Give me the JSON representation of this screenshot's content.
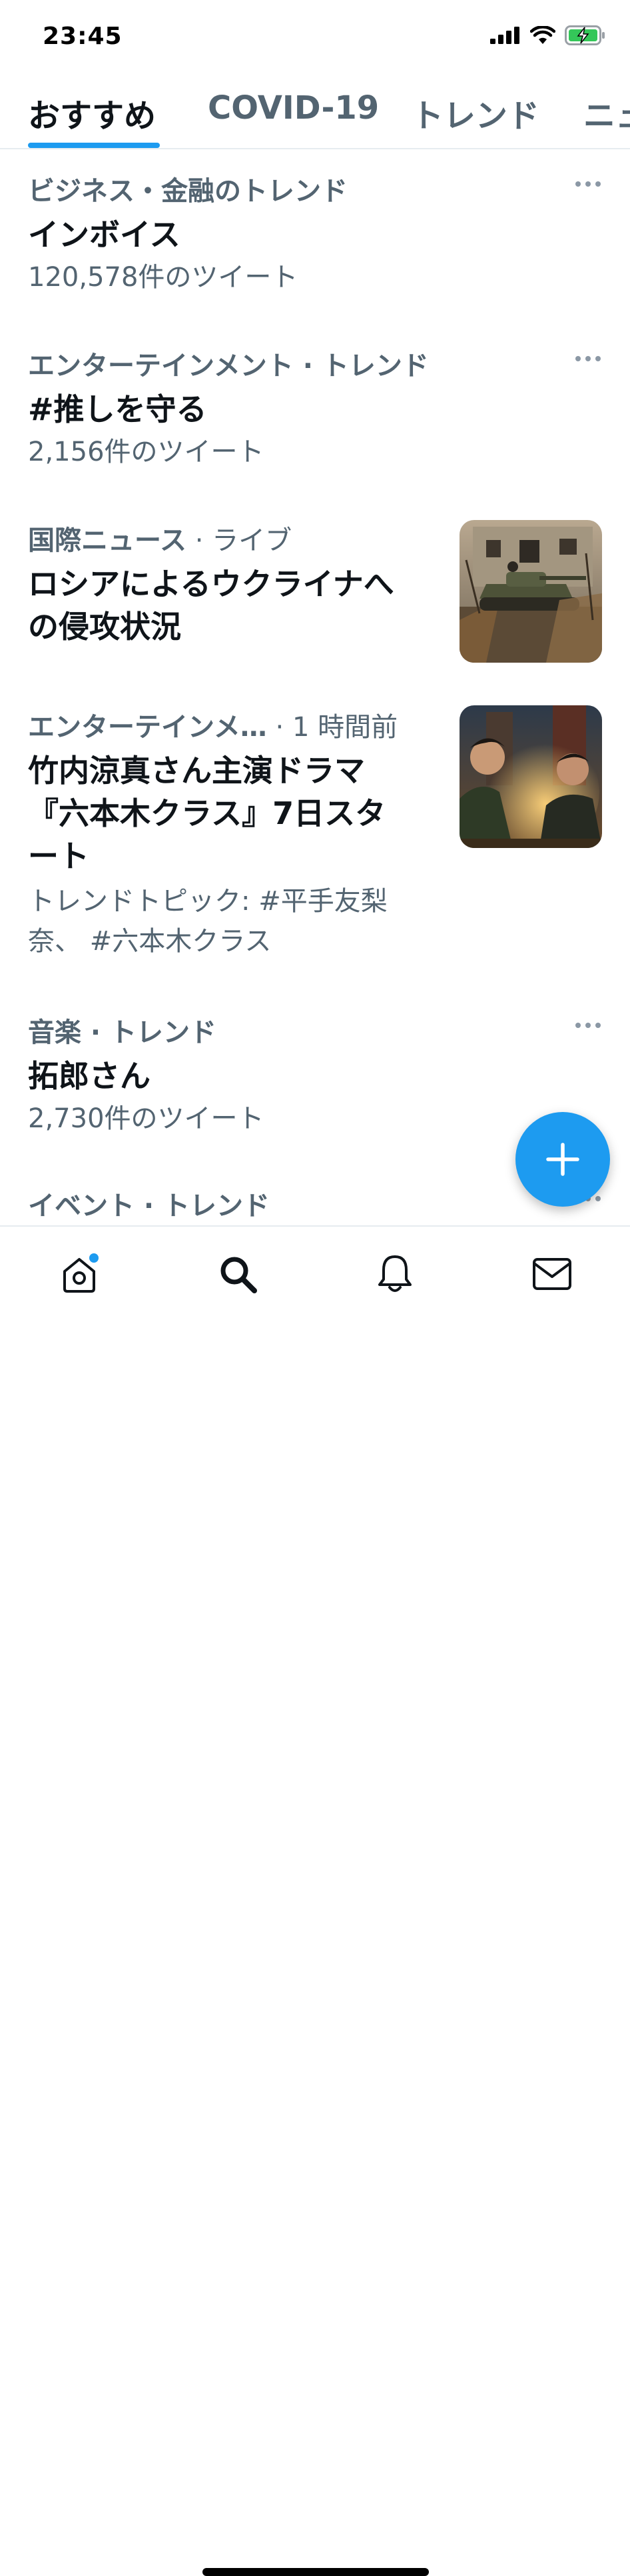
{
  "status_bar": {
    "time": "23:45"
  },
  "tabs": [
    {
      "label": "おすすめ",
      "active": true
    },
    {
      "label": "COVID-19",
      "active": false
    },
    {
      "label": "トレンド",
      "active": false
    },
    {
      "label": "ニュ",
      "active": false
    }
  ],
  "trends": [
    {
      "context": "ビジネス・金融のトレンド",
      "title": "インボイス",
      "count": "120,578件のツイート"
    },
    {
      "context": "エンターテインメント · トレンド",
      "title": "#推しを守る",
      "count": "2,156件のツイート"
    },
    {
      "context": "国際ニュース",
      "context_suffix": " · ライブ",
      "title_lines": [
        "ロシアによるウクライナへ",
        "の侵攻状況"
      ],
      "image": "tank-in-ruins-photo"
    },
    {
      "context": "エンターテインメ…",
      "context_suffix": " · 1 時間前",
      "title_lines": [
        "竹内涼真さん主演ドラマ",
        "『六本木クラス』7日スタ",
        "ート"
      ],
      "sub_lines": [
        "トレンドトピック: #平手友梨",
        "奈、 #六本木クラス"
      ],
      "image": "drama-poster-photo"
    },
    {
      "context": "音楽 · トレンド",
      "title": "拓郎さん",
      "count": "2,730件のツイート"
    },
    {
      "context": "イベント · トレンド"
    }
  ],
  "fab": {
    "icon": "plus-icon"
  },
  "bottom_nav": [
    {
      "name": "home",
      "icon": "home-icon",
      "badge": true
    },
    {
      "name": "search",
      "icon": "search-icon",
      "active": true
    },
    {
      "name": "notifications",
      "icon": "bell-icon"
    },
    {
      "name": "messages",
      "icon": "mail-icon"
    }
  ],
  "colors": {
    "accent": "#1d9bf0",
    "text": "#0f1419",
    "secondary": "#536471"
  }
}
